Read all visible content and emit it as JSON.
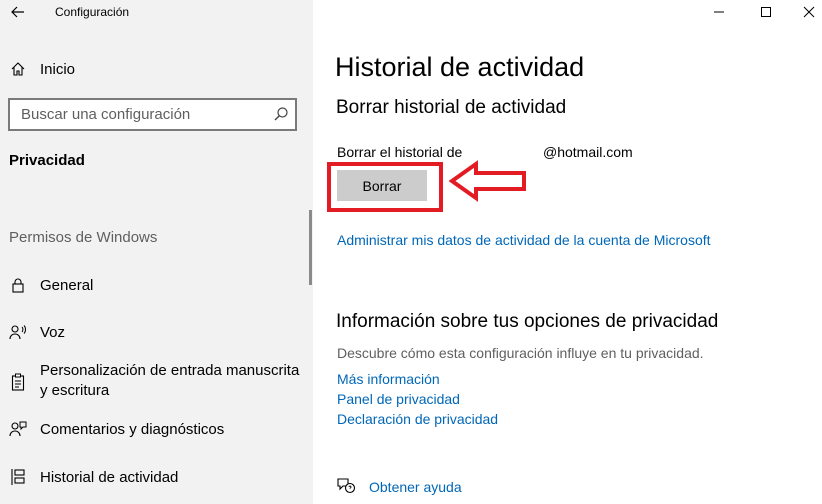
{
  "window": {
    "title": "Configuración"
  },
  "sidebar": {
    "home_label": "Inicio",
    "search_placeholder": "Buscar una configuración",
    "section_title": "Privacidad",
    "group_title": "Permisos de Windows",
    "items": [
      {
        "label": "General",
        "icon": "lock-icon"
      },
      {
        "label": "Voz",
        "icon": "voice-icon"
      },
      {
        "label": "Personalización de entrada manuscrita y escritura",
        "icon": "clipboard-icon"
      },
      {
        "label": "Comentarios y diagnósticos",
        "icon": "feedback-icon"
      },
      {
        "label": "Historial de actividad",
        "icon": "timeline-icon"
      }
    ]
  },
  "main": {
    "title": "Historial de actividad",
    "clear_section": {
      "heading": "Borrar historial de actividad",
      "label": "Borrar el historial de",
      "email": "@hotmail.com",
      "button_label": "Borrar",
      "manage_link": "Administrar mis datos de actividad de la cuenta de Microsoft"
    },
    "privacy_info": {
      "heading": "Información sobre tus opciones de privacidad",
      "description": "Descubre cómo esta configuración influye en tu privacidad.",
      "links": [
        "Más información",
        "Panel de privacidad",
        "Declaración de privacidad"
      ]
    },
    "help_link": "Obtener ayuda"
  },
  "colors": {
    "accent_link": "#0067b8",
    "annotation": "#e31b23",
    "sidebar_bg": "#f2f2f2"
  }
}
